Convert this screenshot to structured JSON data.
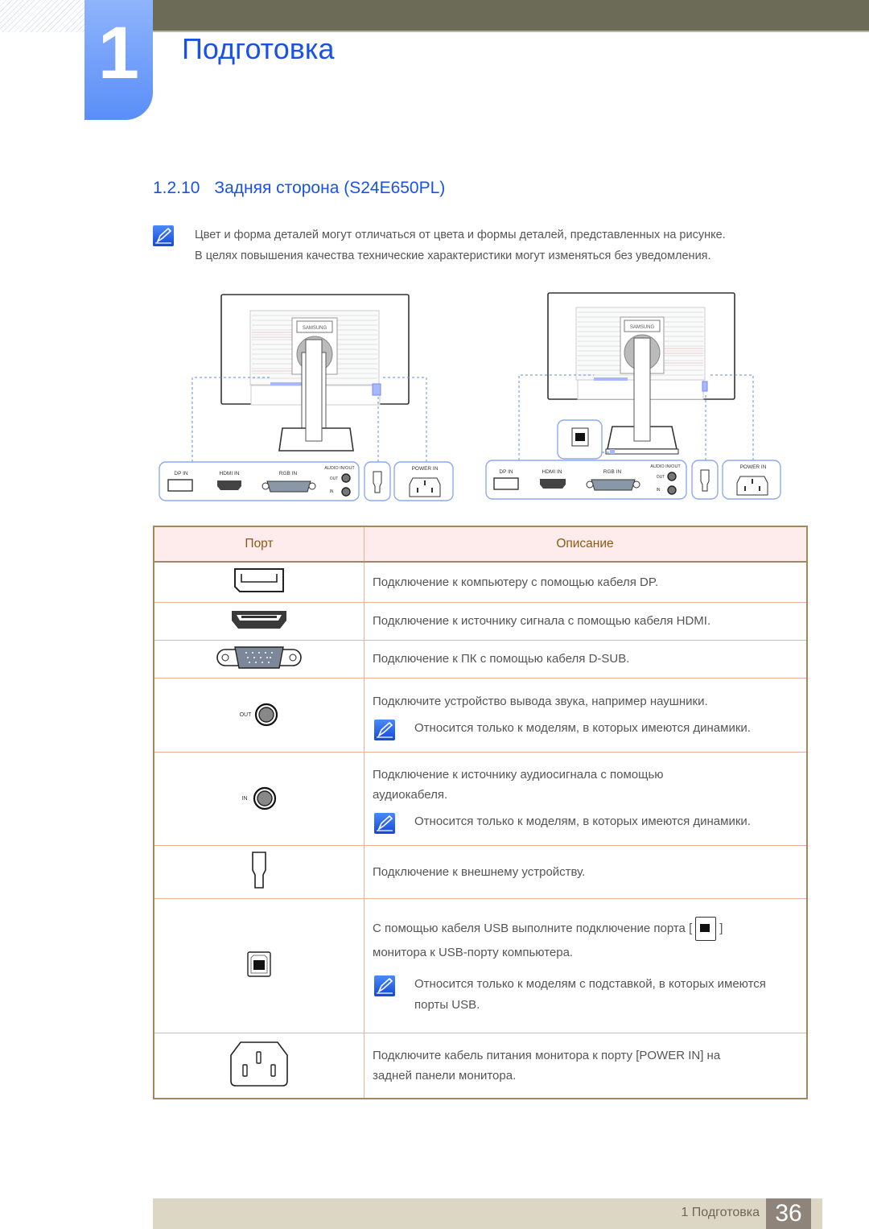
{
  "header": {
    "chapter_number": "1",
    "chapter_title": "Подготовка"
  },
  "section": {
    "number": "1.2.10",
    "title": "Задняя сторона (S24E650PL)"
  },
  "note": {
    "icon": "note-pencil-icon",
    "lines": [
      "Цвет и форма деталей могут отличаться от цвета и формы деталей, представленных на рисунке.",
      "В целях повышения качества технические характеристики могут изменяться без уведомления."
    ]
  },
  "figure": {
    "left": {
      "logo": "SAMSUNG",
      "ports": [
        "DP IN",
        "HDMI IN",
        "RGB IN"
      ],
      "audio_label": "AUDIO IN/OUT",
      "audio_out": "OUT",
      "audio_in": "IN",
      "power_label": "POWER IN"
    },
    "right": {
      "logo": "SAMSUNG",
      "ports": [
        "DP IN",
        "HDMI IN",
        "RGB IN"
      ],
      "audio_label": "AUDIO IN/OUT",
      "audio_out": "OUT",
      "audio_in": "IN",
      "power_label": "POWER IN"
    }
  },
  "table": {
    "headers": {
      "port": "Порт",
      "description": "Описание"
    },
    "rows": [
      {
        "icon": "displayport-icon",
        "lines": [
          "Подключение к компьютеру с помощью кабеля DP."
        ]
      },
      {
        "icon": "hdmi-port-icon",
        "lines": [
          "Подключение к источнику сигнала с помощью кабеля HDMI."
        ]
      },
      {
        "icon": "vga-port-icon",
        "lines": [
          "Подключение к ПК с помощью кабеля D-SUB."
        ]
      },
      {
        "icon": "audio-out-jack-icon",
        "icon_label": "OUT",
        "lines": [
          "Подключите устройство вывода звука, например наушники."
        ],
        "note": "Относится только к моделям, в которых имеются динамики."
      },
      {
        "icon": "audio-in-jack-icon",
        "icon_label": "IN",
        "lines": [
          "Подключение к источнику аудиосигнала с помощью",
          "аудиокабеля."
        ],
        "note": "Относится только к моделям, в которых имеются динамики."
      },
      {
        "icon": "kensington-lock-icon",
        "lines": [
          "Подключение к внешнему устройству."
        ]
      },
      {
        "icon": "usb-b-port-icon",
        "lines": [
          "С помощью кабеля USB выполните подключение порта [",
          "]",
          "монитора к USB-порту компьютера."
        ],
        "note": "Относится только к моделям с подставкой, в которых имеются порты USB."
      },
      {
        "icon": "power-in-port-icon",
        "lines": [
          "Подключите кабель питания монитора к порту [POWER IN] на",
          "задней панели монитора."
        ]
      }
    ]
  },
  "footer": {
    "chapter_label": "1 Подготовка",
    "page_number": "36"
  }
}
